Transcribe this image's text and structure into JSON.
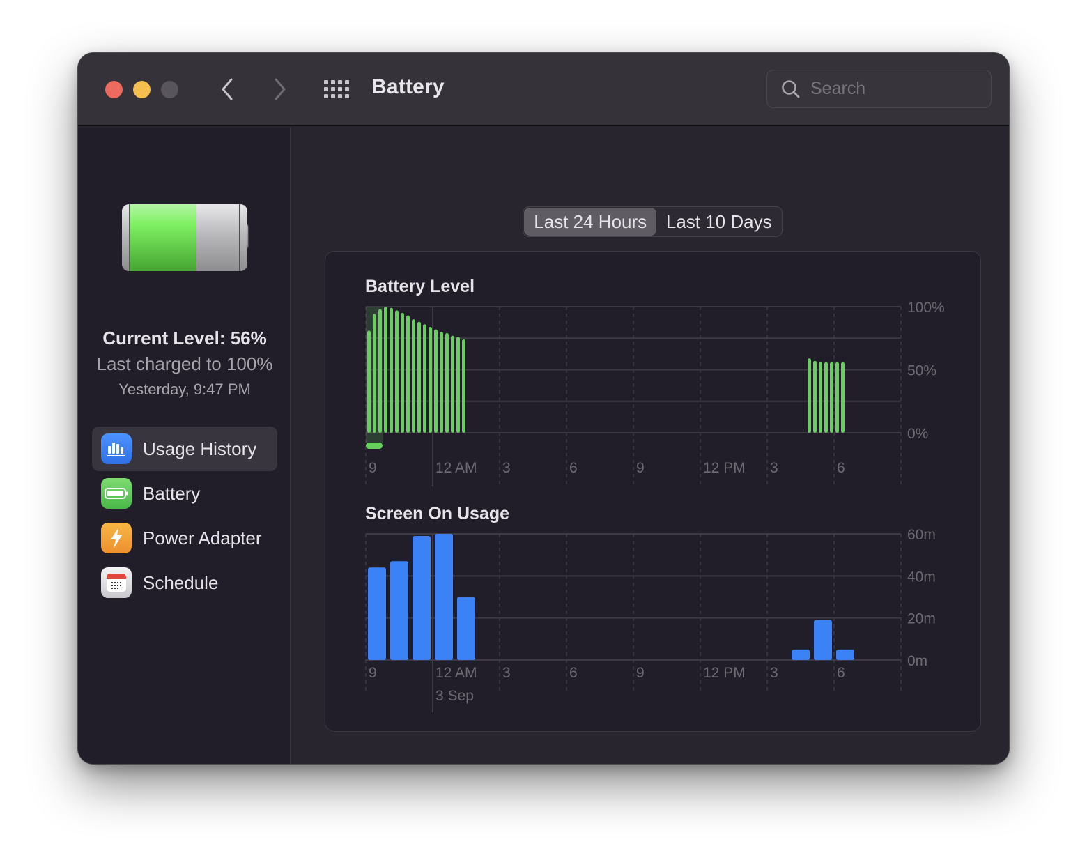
{
  "window": {
    "title": "Battery",
    "traffic_lights": [
      "close",
      "minimize",
      "zoom"
    ],
    "nav": {
      "back_icon": "chevron-left-icon",
      "forward_icon": "chevron-right-icon",
      "grid_icon": "show-all-grid-icon"
    },
    "search": {
      "placeholder": "Search",
      "value": ""
    }
  },
  "sidebar": {
    "battery_level_percent": 56,
    "current_level": "Current Level: 56%",
    "last_charged": "Last charged to 100%",
    "last_charged_time": "Yesterday, 9:47 PM",
    "items": [
      {
        "label": "Usage History",
        "icon": "bar-chart-icon",
        "color": "#3b82f6",
        "active": true
      },
      {
        "label": "Battery",
        "icon": "battery-icon",
        "color": "#5ac85a",
        "active": false
      },
      {
        "label": "Power Adapter",
        "icon": "lightning-bolt-icon",
        "color": "#f3a33a",
        "active": false
      },
      {
        "label": "Schedule",
        "icon": "calendar-icon",
        "color": "#e0e0e4",
        "active": false
      }
    ]
  },
  "main": {
    "tabs": [
      {
        "label": "Last 24 Hours",
        "selected": true
      },
      {
        "label": "Last 10 Days",
        "selected": false
      }
    ],
    "help_label": "?"
  },
  "chart_data": [
    {
      "type": "bar",
      "title": "Battery Level",
      "unit": "%",
      "interval": "15 minutes",
      "ylim": [
        0,
        100
      ],
      "y_ticks": [
        "100%",
        "50%",
        "0%"
      ],
      "x_ticks": [
        "9",
        "12 AM",
        "3",
        "6",
        "9",
        "12 PM",
        "3",
        "6"
      ],
      "color": "#65d05b",
      "charging_highlight": {
        "from_slot": 0,
        "to_slot": 3,
        "color": "#65d05b"
      },
      "series": [
        {
          "start_slot": 0,
          "values": [
            81,
            94,
            98,
            100,
            99,
            97,
            95,
            93,
            90,
            88,
            86,
            84,
            82,
            80,
            79,
            77,
            76,
            74
          ]
        },
        {
          "start_slot": 79,
          "values": [
            59,
            57,
            56,
            56,
            56,
            56,
            56
          ]
        }
      ],
      "grid": true
    },
    {
      "type": "bar",
      "title": "Screen On Usage",
      "unit": "minutes",
      "interval": "1 hour",
      "ylim": [
        0,
        60
      ],
      "y_ticks": [
        "60m",
        "40m",
        "20m",
        "0m"
      ],
      "x_ticks": [
        "9",
        "12 AM",
        "3",
        "6",
        "9",
        "12 PM",
        "3",
        "6"
      ],
      "x_sublabel": {
        "under": "12 AM",
        "text": "3 Sep"
      },
      "color": "#3b82f6",
      "series": [
        {
          "start_hour": 0,
          "values": [
            44,
            47,
            59,
            60,
            30
          ]
        },
        {
          "start_hour": 19,
          "values": [
            5,
            19,
            5
          ]
        }
      ],
      "grid": true
    }
  ]
}
